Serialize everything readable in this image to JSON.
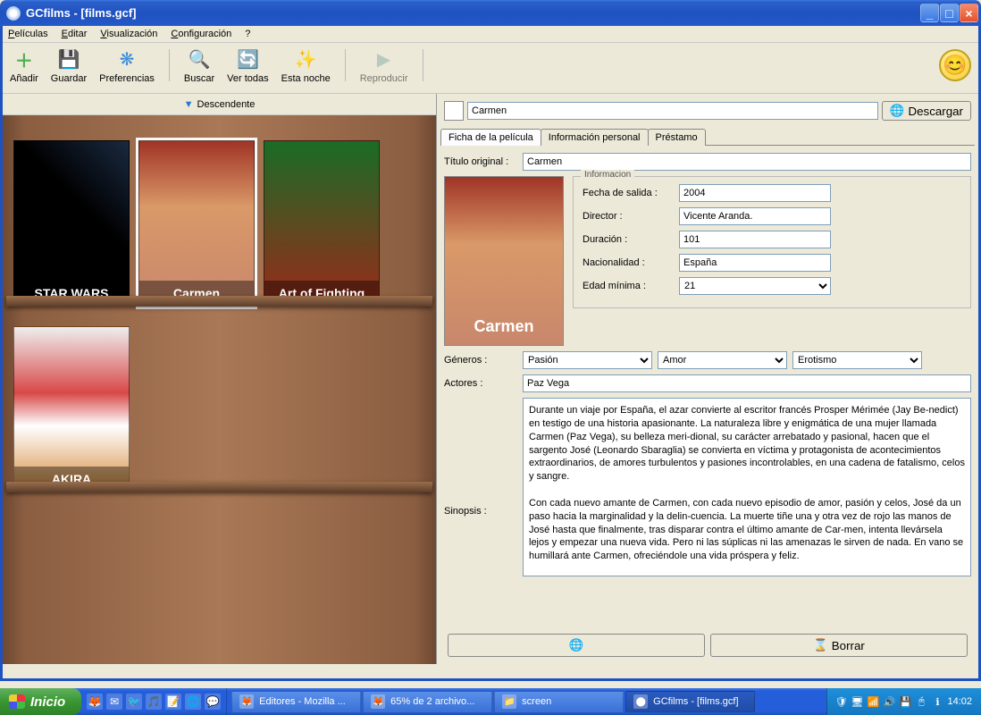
{
  "window": {
    "title": "GCfilms - [films.gcf]"
  },
  "menu": {
    "peliculas": "Películas",
    "editar": "Editar",
    "visualizacion": "Visualización",
    "configuracion": "Configuración",
    "help": "?"
  },
  "toolbar": {
    "anadir": "Añadir",
    "guardar": "Guardar",
    "preferencias": "Preferencias",
    "buscar": "Buscar",
    "vertodas": "Ver todas",
    "estanoche": "Esta noche",
    "reproducir": "Reproducir"
  },
  "sort": {
    "label": "Descendente"
  },
  "films": [
    {
      "name": "STAR WARS",
      "css": "cover-sw"
    },
    {
      "name": "Carmen",
      "css": "cover-carmen",
      "selected": true
    },
    {
      "name": "Art of Fighting",
      "css": "cover-aof"
    },
    {
      "name": "AKIRA",
      "css": "cover-akira"
    }
  ],
  "detail": {
    "title_value": "Carmen",
    "download": "Descargar",
    "tabs": {
      "ficha": "Ficha de la película",
      "info": "Información personal",
      "prestamo": "Préstamo"
    },
    "titulo_label": "Título original :",
    "titulo_value": "Carmen",
    "info_legend": "Informacion",
    "fecha_label": "Fecha de salida :",
    "fecha_value": "2004",
    "director_label": "Director :",
    "director_value": "Vicente Aranda.",
    "duracion_label": "Duración :",
    "duracion_value": "101",
    "nacionalidad_label": "Nacionalidad :",
    "nacionalidad_value": "España",
    "edad_label": "Edad mínima :",
    "edad_value": "21",
    "generos_label": "Géneros :",
    "g1": "Pasión",
    "g2": "Amor",
    "g3": "Erotismo",
    "actores_label": "Actores :",
    "actores_value": "Paz Vega",
    "sinopsis_label": "Sinopsis :",
    "sinopsis_value": "Durante un viaje por España, el azar convierte al escritor francés Prosper Mérimée (Jay Be-nedict) en testigo de una historia apasionante. La naturaleza libre y enigmática de una mujer llamada Carmen (Paz Vega), su belleza meri-dional, su carácter arrebatado y pasional, hacen que el sargento José (Leonardo Sbaraglia) se convierta en víctima y protagonista de acontecimientos extraordinarios, de amores turbulentos y pasiones incontrolables, en una cadena de fatalismo, celos y sangre.\n\nCon cada nuevo amante de Carmen, con cada nuevo episodio de amor, pasión y celos, José da un paso hacia la marginalidad y la delin-cuencia. La muerte tiñe una y otra vez de rojo las manos de José hasta que finalmente, tras disparar contra el último amante de Car-men, intenta llevársela lejos y empezar una nueva vida. Pero ni las súplicas ni las amenazas le sirven de nada. En vano se humillará ante Carmen, ofreciéndole una vida próspera y feliz.\n\nLas apasiona-das palabras de amor caen en el vacío y en la más terrible de las indiferencias. Y la impotencia y la pasión empujan una vez más la mano de José hacia la navaja desnuda. ¿Qué otra cosa podía ha-cer? Si cada episodio de amor es una pequeña muerte, ¿cómo se puede retener todo",
    "borrar": "Borrar"
  },
  "taskbar": {
    "start": "Inicio",
    "task1": "Editores - Mozilla ...",
    "task2": "65% de 2 archivo...",
    "task3": "screen",
    "task4": "GCfilms - [films.gcf]",
    "clock": "14:02"
  }
}
